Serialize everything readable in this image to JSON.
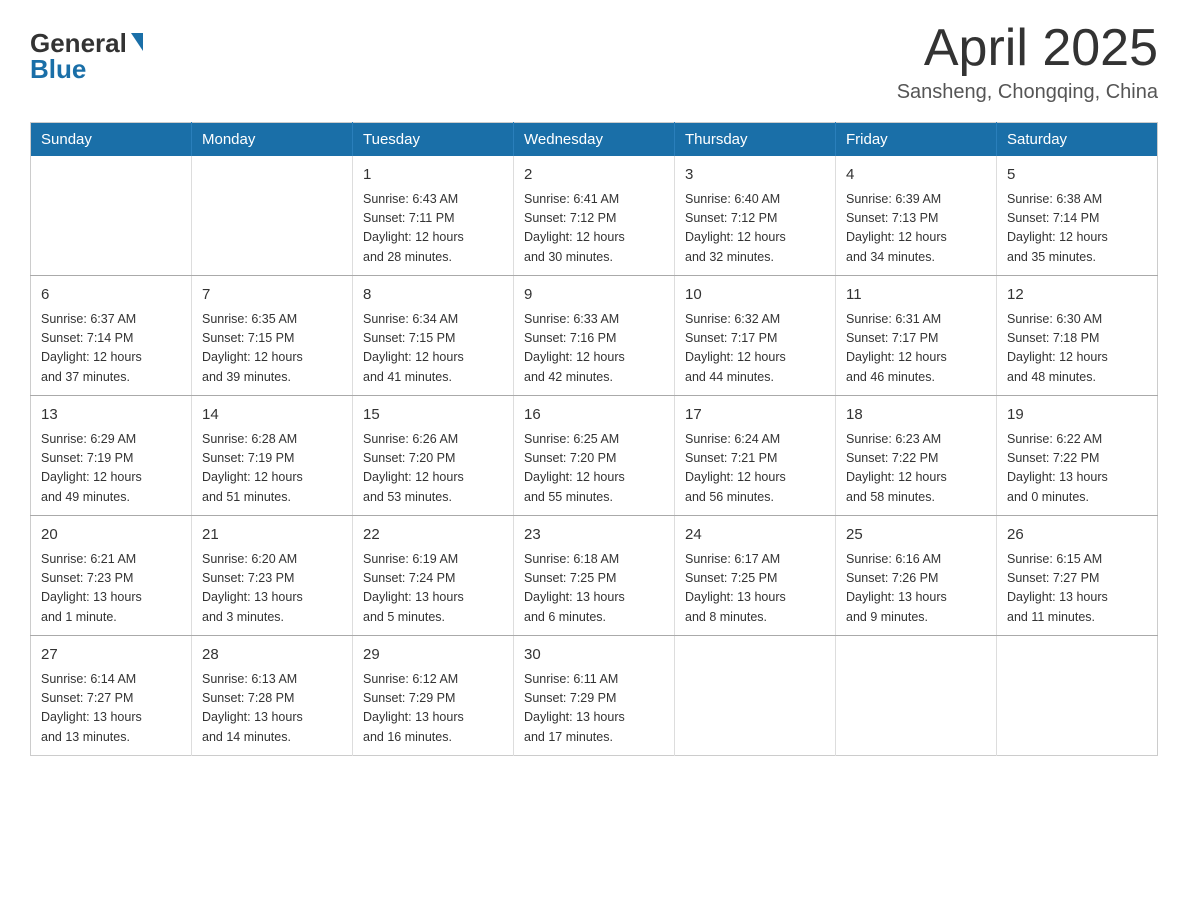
{
  "logo": {
    "general": "General",
    "blue": "Blue"
  },
  "header": {
    "month": "April 2025",
    "location": "Sansheng, Chongqing, China"
  },
  "weekdays": [
    "Sunday",
    "Monday",
    "Tuesday",
    "Wednesday",
    "Thursday",
    "Friday",
    "Saturday"
  ],
  "weeks": [
    [
      {
        "day": "",
        "info": ""
      },
      {
        "day": "",
        "info": ""
      },
      {
        "day": "1",
        "info": "Sunrise: 6:43 AM\nSunset: 7:11 PM\nDaylight: 12 hours\nand 28 minutes."
      },
      {
        "day": "2",
        "info": "Sunrise: 6:41 AM\nSunset: 7:12 PM\nDaylight: 12 hours\nand 30 minutes."
      },
      {
        "day": "3",
        "info": "Sunrise: 6:40 AM\nSunset: 7:12 PM\nDaylight: 12 hours\nand 32 minutes."
      },
      {
        "day": "4",
        "info": "Sunrise: 6:39 AM\nSunset: 7:13 PM\nDaylight: 12 hours\nand 34 minutes."
      },
      {
        "day": "5",
        "info": "Sunrise: 6:38 AM\nSunset: 7:14 PM\nDaylight: 12 hours\nand 35 minutes."
      }
    ],
    [
      {
        "day": "6",
        "info": "Sunrise: 6:37 AM\nSunset: 7:14 PM\nDaylight: 12 hours\nand 37 minutes."
      },
      {
        "day": "7",
        "info": "Sunrise: 6:35 AM\nSunset: 7:15 PM\nDaylight: 12 hours\nand 39 minutes."
      },
      {
        "day": "8",
        "info": "Sunrise: 6:34 AM\nSunset: 7:15 PM\nDaylight: 12 hours\nand 41 minutes."
      },
      {
        "day": "9",
        "info": "Sunrise: 6:33 AM\nSunset: 7:16 PM\nDaylight: 12 hours\nand 42 minutes."
      },
      {
        "day": "10",
        "info": "Sunrise: 6:32 AM\nSunset: 7:17 PM\nDaylight: 12 hours\nand 44 minutes."
      },
      {
        "day": "11",
        "info": "Sunrise: 6:31 AM\nSunset: 7:17 PM\nDaylight: 12 hours\nand 46 minutes."
      },
      {
        "day": "12",
        "info": "Sunrise: 6:30 AM\nSunset: 7:18 PM\nDaylight: 12 hours\nand 48 minutes."
      }
    ],
    [
      {
        "day": "13",
        "info": "Sunrise: 6:29 AM\nSunset: 7:19 PM\nDaylight: 12 hours\nand 49 minutes."
      },
      {
        "day": "14",
        "info": "Sunrise: 6:28 AM\nSunset: 7:19 PM\nDaylight: 12 hours\nand 51 minutes."
      },
      {
        "day": "15",
        "info": "Sunrise: 6:26 AM\nSunset: 7:20 PM\nDaylight: 12 hours\nand 53 minutes."
      },
      {
        "day": "16",
        "info": "Sunrise: 6:25 AM\nSunset: 7:20 PM\nDaylight: 12 hours\nand 55 minutes."
      },
      {
        "day": "17",
        "info": "Sunrise: 6:24 AM\nSunset: 7:21 PM\nDaylight: 12 hours\nand 56 minutes."
      },
      {
        "day": "18",
        "info": "Sunrise: 6:23 AM\nSunset: 7:22 PM\nDaylight: 12 hours\nand 58 minutes."
      },
      {
        "day": "19",
        "info": "Sunrise: 6:22 AM\nSunset: 7:22 PM\nDaylight: 13 hours\nand 0 minutes."
      }
    ],
    [
      {
        "day": "20",
        "info": "Sunrise: 6:21 AM\nSunset: 7:23 PM\nDaylight: 13 hours\nand 1 minute."
      },
      {
        "day": "21",
        "info": "Sunrise: 6:20 AM\nSunset: 7:23 PM\nDaylight: 13 hours\nand 3 minutes."
      },
      {
        "day": "22",
        "info": "Sunrise: 6:19 AM\nSunset: 7:24 PM\nDaylight: 13 hours\nand 5 minutes."
      },
      {
        "day": "23",
        "info": "Sunrise: 6:18 AM\nSunset: 7:25 PM\nDaylight: 13 hours\nand 6 minutes."
      },
      {
        "day": "24",
        "info": "Sunrise: 6:17 AM\nSunset: 7:25 PM\nDaylight: 13 hours\nand 8 minutes."
      },
      {
        "day": "25",
        "info": "Sunrise: 6:16 AM\nSunset: 7:26 PM\nDaylight: 13 hours\nand 9 minutes."
      },
      {
        "day": "26",
        "info": "Sunrise: 6:15 AM\nSunset: 7:27 PM\nDaylight: 13 hours\nand 11 minutes."
      }
    ],
    [
      {
        "day": "27",
        "info": "Sunrise: 6:14 AM\nSunset: 7:27 PM\nDaylight: 13 hours\nand 13 minutes."
      },
      {
        "day": "28",
        "info": "Sunrise: 6:13 AM\nSunset: 7:28 PM\nDaylight: 13 hours\nand 14 minutes."
      },
      {
        "day": "29",
        "info": "Sunrise: 6:12 AM\nSunset: 7:29 PM\nDaylight: 13 hours\nand 16 minutes."
      },
      {
        "day": "30",
        "info": "Sunrise: 6:11 AM\nSunset: 7:29 PM\nDaylight: 13 hours\nand 17 minutes."
      },
      {
        "day": "",
        "info": ""
      },
      {
        "day": "",
        "info": ""
      },
      {
        "day": "",
        "info": ""
      }
    ]
  ]
}
